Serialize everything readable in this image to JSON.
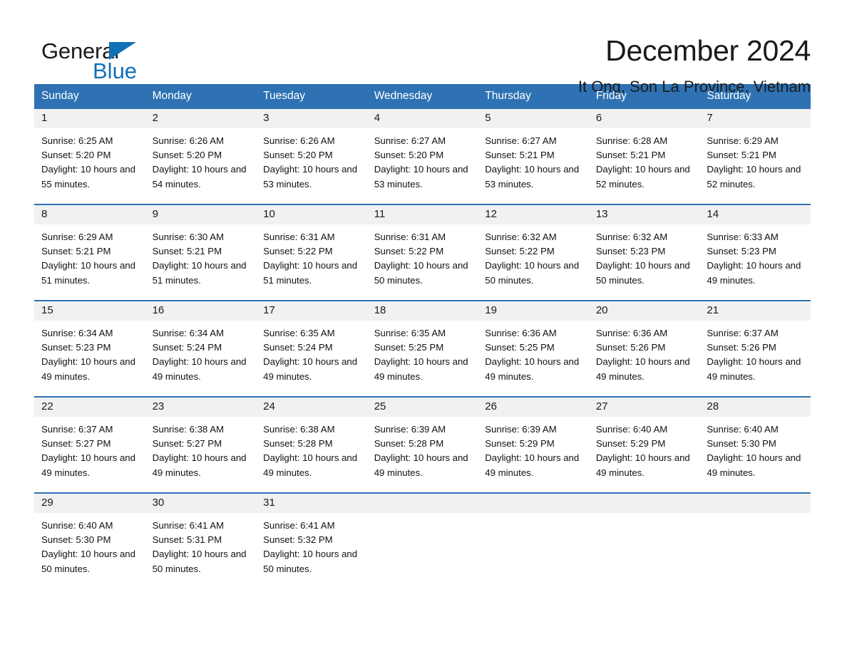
{
  "brand": {
    "name_part1": "General",
    "name_part2": "Blue",
    "accent_color": "#1070b8"
  },
  "header": {
    "title": "December 2024",
    "location": "It Ong, Son La Province, Vietnam"
  },
  "theme": {
    "header_blue": "#2e72b4",
    "daynum_band": "#f1f1f1",
    "text": "#111111"
  },
  "calendar": {
    "weekday_headers": [
      "Sunday",
      "Monday",
      "Tuesday",
      "Wednesday",
      "Thursday",
      "Friday",
      "Saturday"
    ],
    "labels": {
      "sunrise_prefix": "Sunrise:",
      "sunset_prefix": "Sunset:",
      "daylight_prefix": "Daylight:"
    },
    "weeks": [
      [
        {
          "day": "1",
          "sunrise": "Sunrise: 6:25 AM",
          "sunset": "Sunset: 5:20 PM",
          "daylight": "Daylight: 10 hours and 55 minutes."
        },
        {
          "day": "2",
          "sunrise": "Sunrise: 6:26 AM",
          "sunset": "Sunset: 5:20 PM",
          "daylight": "Daylight: 10 hours and 54 minutes."
        },
        {
          "day": "3",
          "sunrise": "Sunrise: 6:26 AM",
          "sunset": "Sunset: 5:20 PM",
          "daylight": "Daylight: 10 hours and 53 minutes."
        },
        {
          "day": "4",
          "sunrise": "Sunrise: 6:27 AM",
          "sunset": "Sunset: 5:20 PM",
          "daylight": "Daylight: 10 hours and 53 minutes."
        },
        {
          "day": "5",
          "sunrise": "Sunrise: 6:27 AM",
          "sunset": "Sunset: 5:21 PM",
          "daylight": "Daylight: 10 hours and 53 minutes."
        },
        {
          "day": "6",
          "sunrise": "Sunrise: 6:28 AM",
          "sunset": "Sunset: 5:21 PM",
          "daylight": "Daylight: 10 hours and 52 minutes."
        },
        {
          "day": "7",
          "sunrise": "Sunrise: 6:29 AM",
          "sunset": "Sunset: 5:21 PM",
          "daylight": "Daylight: 10 hours and 52 minutes."
        }
      ],
      [
        {
          "day": "8",
          "sunrise": "Sunrise: 6:29 AM",
          "sunset": "Sunset: 5:21 PM",
          "daylight": "Daylight: 10 hours and 51 minutes."
        },
        {
          "day": "9",
          "sunrise": "Sunrise: 6:30 AM",
          "sunset": "Sunset: 5:21 PM",
          "daylight": "Daylight: 10 hours and 51 minutes."
        },
        {
          "day": "10",
          "sunrise": "Sunrise: 6:31 AM",
          "sunset": "Sunset: 5:22 PM",
          "daylight": "Daylight: 10 hours and 51 minutes."
        },
        {
          "day": "11",
          "sunrise": "Sunrise: 6:31 AM",
          "sunset": "Sunset: 5:22 PM",
          "daylight": "Daylight: 10 hours and 50 minutes."
        },
        {
          "day": "12",
          "sunrise": "Sunrise: 6:32 AM",
          "sunset": "Sunset: 5:22 PM",
          "daylight": "Daylight: 10 hours and 50 minutes."
        },
        {
          "day": "13",
          "sunrise": "Sunrise: 6:32 AM",
          "sunset": "Sunset: 5:23 PM",
          "daylight": "Daylight: 10 hours and 50 minutes."
        },
        {
          "day": "14",
          "sunrise": "Sunrise: 6:33 AM",
          "sunset": "Sunset: 5:23 PM",
          "daylight": "Daylight: 10 hours and 49 minutes."
        }
      ],
      [
        {
          "day": "15",
          "sunrise": "Sunrise: 6:34 AM",
          "sunset": "Sunset: 5:23 PM",
          "daylight": "Daylight: 10 hours and 49 minutes."
        },
        {
          "day": "16",
          "sunrise": "Sunrise: 6:34 AM",
          "sunset": "Sunset: 5:24 PM",
          "daylight": "Daylight: 10 hours and 49 minutes."
        },
        {
          "day": "17",
          "sunrise": "Sunrise: 6:35 AM",
          "sunset": "Sunset: 5:24 PM",
          "daylight": "Daylight: 10 hours and 49 minutes."
        },
        {
          "day": "18",
          "sunrise": "Sunrise: 6:35 AM",
          "sunset": "Sunset: 5:25 PM",
          "daylight": "Daylight: 10 hours and 49 minutes."
        },
        {
          "day": "19",
          "sunrise": "Sunrise: 6:36 AM",
          "sunset": "Sunset: 5:25 PM",
          "daylight": "Daylight: 10 hours and 49 minutes."
        },
        {
          "day": "20",
          "sunrise": "Sunrise: 6:36 AM",
          "sunset": "Sunset: 5:26 PM",
          "daylight": "Daylight: 10 hours and 49 minutes."
        },
        {
          "day": "21",
          "sunrise": "Sunrise: 6:37 AM",
          "sunset": "Sunset: 5:26 PM",
          "daylight": "Daylight: 10 hours and 49 minutes."
        }
      ],
      [
        {
          "day": "22",
          "sunrise": "Sunrise: 6:37 AM",
          "sunset": "Sunset: 5:27 PM",
          "daylight": "Daylight: 10 hours and 49 minutes."
        },
        {
          "day": "23",
          "sunrise": "Sunrise: 6:38 AM",
          "sunset": "Sunset: 5:27 PM",
          "daylight": "Daylight: 10 hours and 49 minutes."
        },
        {
          "day": "24",
          "sunrise": "Sunrise: 6:38 AM",
          "sunset": "Sunset: 5:28 PM",
          "daylight": "Daylight: 10 hours and 49 minutes."
        },
        {
          "day": "25",
          "sunrise": "Sunrise: 6:39 AM",
          "sunset": "Sunset: 5:28 PM",
          "daylight": "Daylight: 10 hours and 49 minutes."
        },
        {
          "day": "26",
          "sunrise": "Sunrise: 6:39 AM",
          "sunset": "Sunset: 5:29 PM",
          "daylight": "Daylight: 10 hours and 49 minutes."
        },
        {
          "day": "27",
          "sunrise": "Sunrise: 6:40 AM",
          "sunset": "Sunset: 5:29 PM",
          "daylight": "Daylight: 10 hours and 49 minutes."
        },
        {
          "day": "28",
          "sunrise": "Sunrise: 6:40 AM",
          "sunset": "Sunset: 5:30 PM",
          "daylight": "Daylight: 10 hours and 49 minutes."
        }
      ],
      [
        {
          "day": "29",
          "sunrise": "Sunrise: 6:40 AM",
          "sunset": "Sunset: 5:30 PM",
          "daylight": "Daylight: 10 hours and 50 minutes."
        },
        {
          "day": "30",
          "sunrise": "Sunrise: 6:41 AM",
          "sunset": "Sunset: 5:31 PM",
          "daylight": "Daylight: 10 hours and 50 minutes."
        },
        {
          "day": "31",
          "sunrise": "Sunrise: 6:41 AM",
          "sunset": "Sunset: 5:32 PM",
          "daylight": "Daylight: 10 hours and 50 minutes."
        },
        {
          "day": "",
          "sunrise": "",
          "sunset": "",
          "daylight": ""
        },
        {
          "day": "",
          "sunrise": "",
          "sunset": "",
          "daylight": ""
        },
        {
          "day": "",
          "sunrise": "",
          "sunset": "",
          "daylight": ""
        },
        {
          "day": "",
          "sunrise": "",
          "sunset": "",
          "daylight": ""
        }
      ]
    ]
  }
}
